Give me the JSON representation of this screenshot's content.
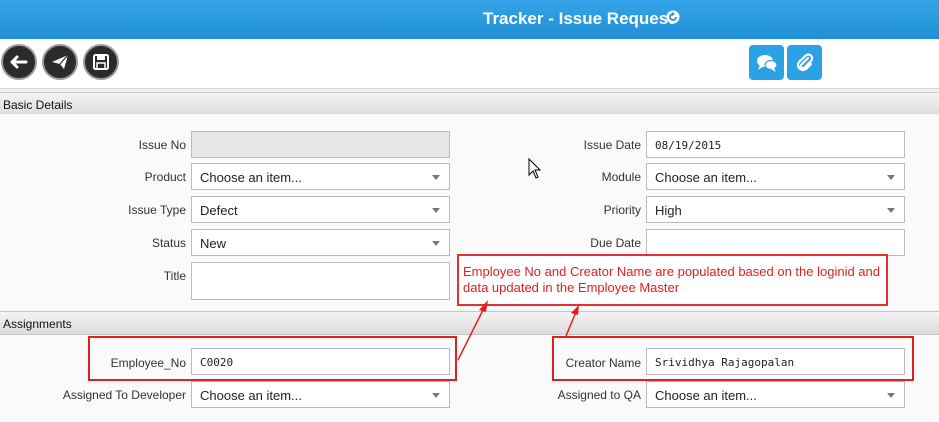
{
  "header": {
    "title": "Tracker - Issue Request"
  },
  "toolbar": {
    "back_icon": "arrow-left-icon",
    "send_icon": "paper-plane-icon",
    "save_icon": "floppy-disk-icon",
    "comment_icon": "chat-bubbles-icon",
    "attach_icon": "paperclip-icon"
  },
  "sections": {
    "basic": "Basic Details",
    "assignments": "Assignments"
  },
  "basic": {
    "issue_no": {
      "label": "Issue No",
      "value": ""
    },
    "issue_date": {
      "label": "Issue Date",
      "value": "08/19/2015"
    },
    "product": {
      "label": "Product",
      "value": "Choose an item..."
    },
    "module": {
      "label": "Module",
      "value": "Choose an item..."
    },
    "issue_type": {
      "label": "Issue Type",
      "value": "Defect"
    },
    "priority": {
      "label": "Priority",
      "value": "High"
    },
    "status": {
      "label": "Status",
      "value": "New"
    },
    "due_date": {
      "label": "Due Date",
      "value": ""
    },
    "title": {
      "label": "Title",
      "value": ""
    }
  },
  "assignments": {
    "employee_no": {
      "label": "Employee_No",
      "value": "C0020"
    },
    "creator_name": {
      "label": "Creator Name",
      "value": "Srividhya Rajagopalan"
    },
    "assigned_dev": {
      "label": "Assigned To Developer",
      "value": "Choose an item..."
    },
    "assigned_qa": {
      "label": "Assigned to QA",
      "value": "Choose an item..."
    }
  },
  "callout": {
    "text": "Employee No and Creator Name are populated based on the loginid and data updated in the Employee Master"
  },
  "colors": {
    "header_blue": "#1f8fd6",
    "button_blue": "#29a3e6",
    "annotation_red": "#e02020"
  }
}
